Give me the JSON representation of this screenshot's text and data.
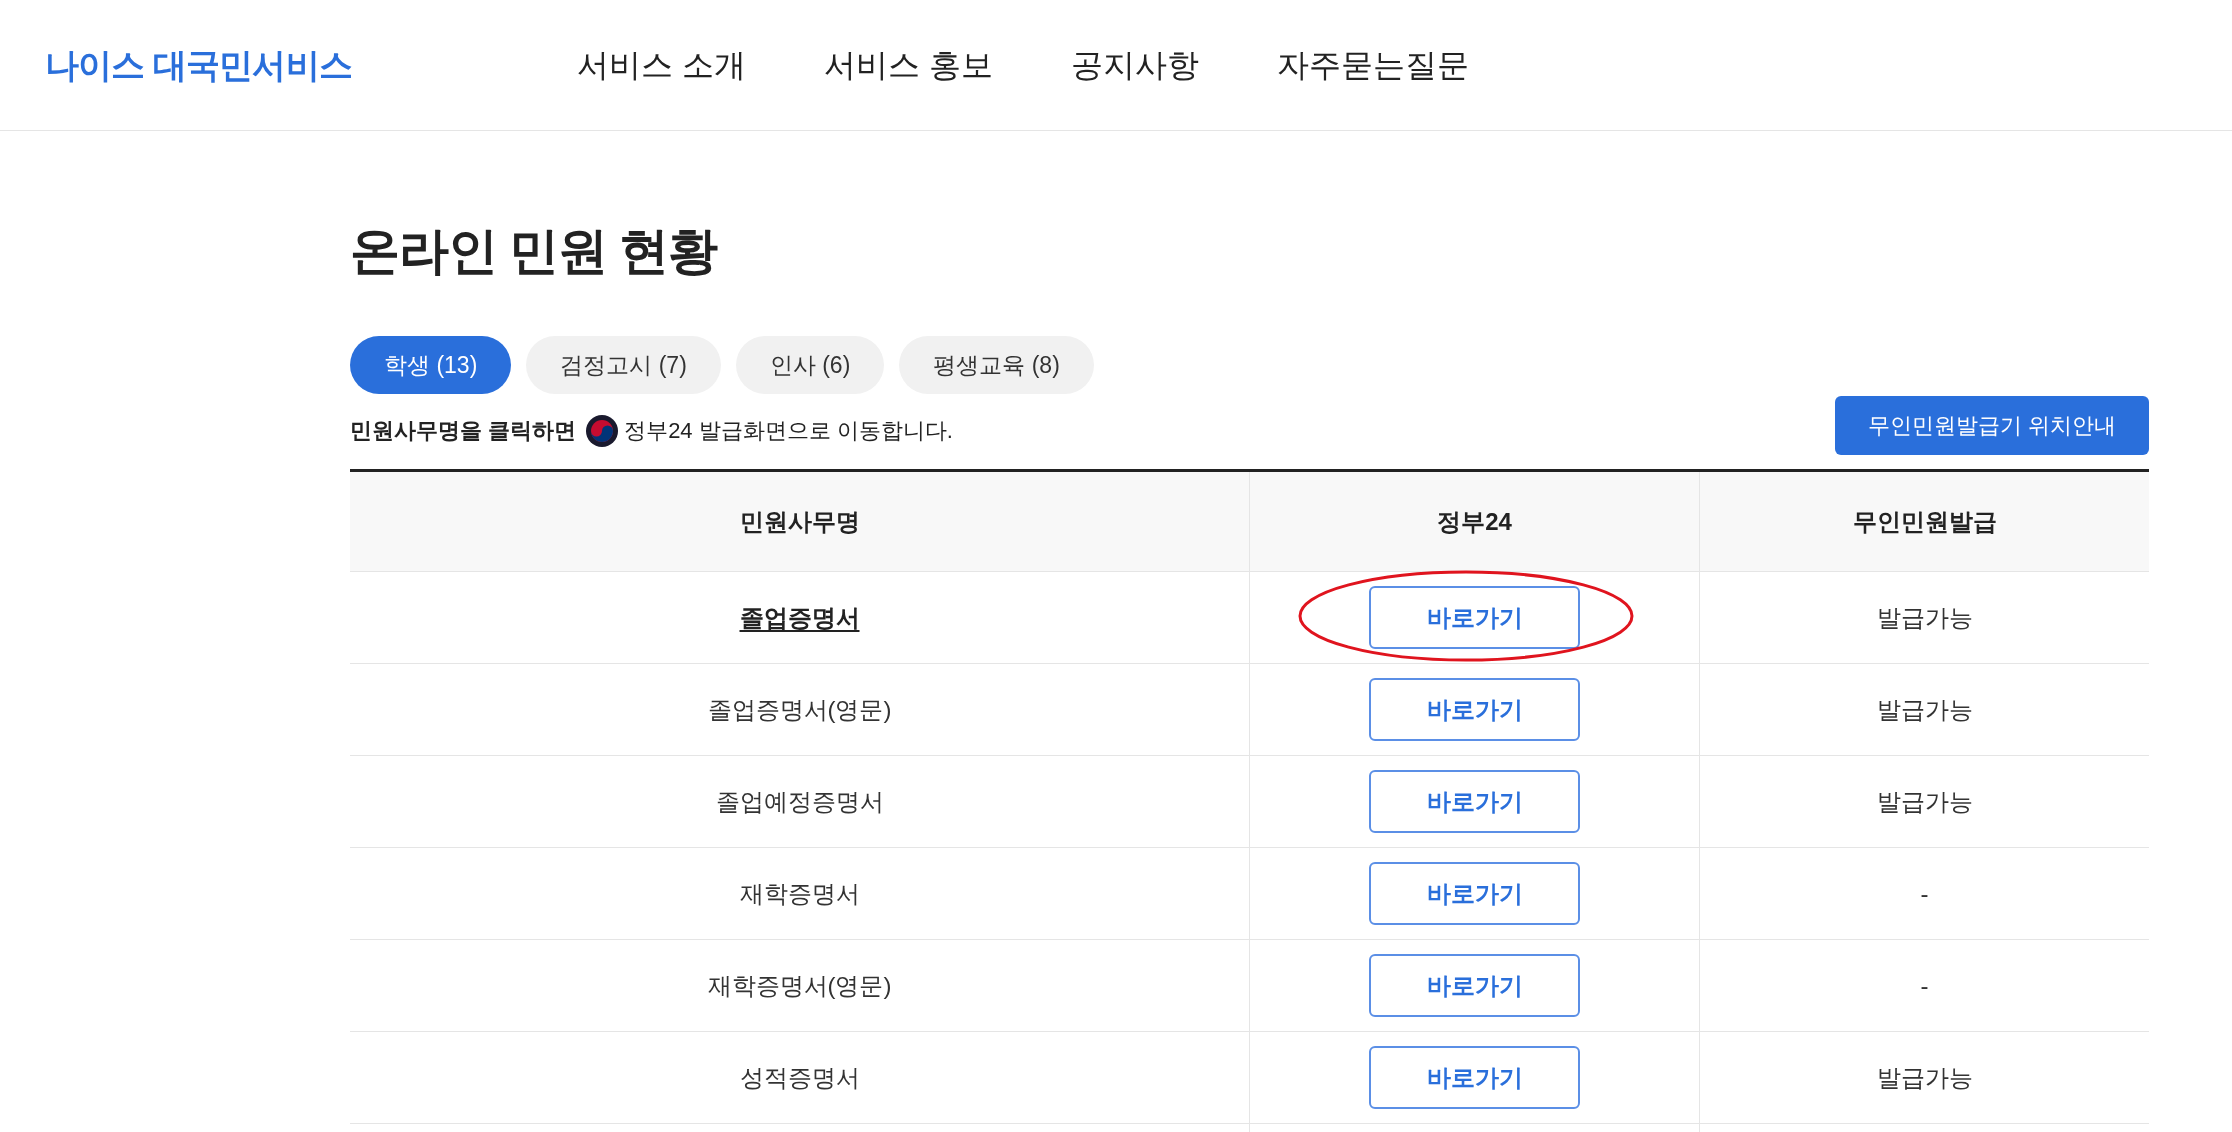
{
  "header": {
    "logo": "나이스 대국민서비스",
    "nav": [
      "서비스 소개",
      "서비스 홍보",
      "공지사항",
      "자주묻는질문"
    ]
  },
  "page_title": "온라인 민원 현황",
  "tabs": [
    {
      "label": "학생 (13)",
      "selected": true
    },
    {
      "label": "검정고시 (7)",
      "selected": false
    },
    {
      "label": "인사 (6)",
      "selected": false
    },
    {
      "label": "평생교육 (8)",
      "selected": false
    }
  ],
  "notice": {
    "lead": "민원사무명을 클릭하면",
    "rest": "정부24 발급화면으로 이동합니다."
  },
  "kiosk_button": "무인민원발급기 위치안내",
  "table": {
    "columns": [
      "민원사무명",
      "정부24",
      "무인민원발급"
    ],
    "rows": [
      {
        "name": "졸업증명서",
        "link": "바로가기",
        "kiosk": "발급가능",
        "emphasized": true,
        "circled": true
      },
      {
        "name": "졸업증명서(영문)",
        "link": "바로가기",
        "kiosk": "발급가능",
        "emphasized": false,
        "circled": false
      },
      {
        "name": "졸업예정증명서",
        "link": "바로가기",
        "kiosk": "발급가능",
        "emphasized": false,
        "circled": false
      },
      {
        "name": "재학증명서",
        "link": "바로가기",
        "kiosk": "-",
        "emphasized": false,
        "circled": false
      },
      {
        "name": "재학증명서(영문)",
        "link": "바로가기",
        "kiosk": "-",
        "emphasized": false,
        "circled": false
      },
      {
        "name": "성적증명서",
        "link": "바로가기",
        "kiosk": "발급가능",
        "emphasized": false,
        "circled": false
      }
    ]
  }
}
